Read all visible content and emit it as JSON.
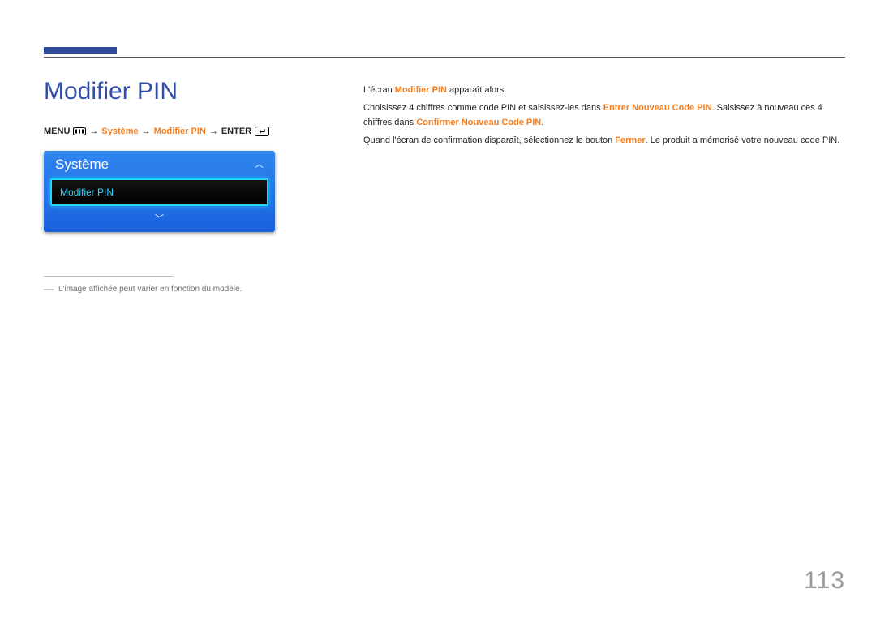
{
  "page_number": "113",
  "left": {
    "title": "Modifier PIN",
    "breadcrumb": {
      "menu": "MENU",
      "step1": "Système",
      "step2": "Modifier PIN",
      "enter": "ENTER"
    },
    "menu_widget": {
      "header": "Système",
      "selected_item": "Modifier PIN"
    },
    "footnote": "L'image affichée peut varier en fonction du modèle."
  },
  "right": {
    "p1_prefix": "L'écran ",
    "p1_strong": "Modifier PIN",
    "p1_suffix": " apparaît alors.",
    "p2_prefix": "Choisissez 4 chiffres comme code PIN et saisissez-les dans ",
    "p2_strong1": "Entrer Nouveau Code PIN",
    "p2_mid": ". Saisissez à nouveau ces 4 chiffres dans ",
    "p2_strong2": "Confirmer Nouveau Code PIN",
    "p2_suffix": ".",
    "p3_prefix": "Quand l'écran de confirmation disparaît, sélectionnez le bouton ",
    "p3_strong": "Fermer",
    "p3_suffix": ". Le produit a mémorisé votre nouveau code PIN."
  }
}
